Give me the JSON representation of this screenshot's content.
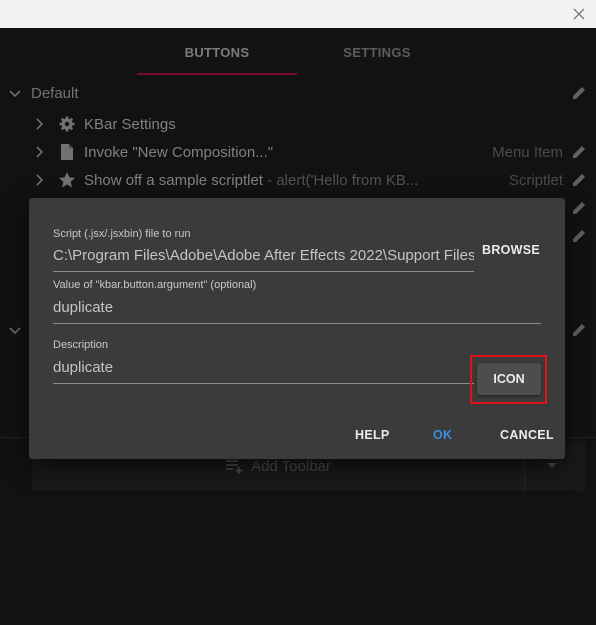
{
  "tabs": [
    {
      "label": "BUTTONS",
      "active": true
    },
    {
      "label": "SETTINGS",
      "active": false
    }
  ],
  "toolbar_group": {
    "name": "Default"
  },
  "items": [
    {
      "icon": "gear-icon",
      "label": "KBar Settings",
      "sub": "",
      "type": ""
    },
    {
      "icon": "file-icon",
      "label": "Invoke \"New Composition...\"",
      "sub": "",
      "type": "Menu Item"
    },
    {
      "icon": "star-icon",
      "label": "Show off a sample scriptlet",
      "sub": " - alert('Hello from KB...",
      "type": "Scriptlet"
    }
  ],
  "add_toolbar_label": "Add Toolbar",
  "dialog": {
    "script_label": "Script (.jsx/.jsxbin) file to run",
    "script_value": "C:\\Program Files\\Adobe\\Adobe After Effects 2022\\Support Files\\",
    "browse_label": "BROWSE",
    "argument_label": "Value of \"kbar.button.argument\" (optional)",
    "argument_value": "duplicate",
    "description_label": "Description",
    "description_value": "duplicate",
    "icon_label": "ICON",
    "help_label": "HELP",
    "ok_label": "OK",
    "cancel_label": "CANCEL"
  },
  "colors": {
    "accent_tab": "#b3123b",
    "ok_blue": "#3b8fe0",
    "highlight_red": "#e0121b"
  }
}
